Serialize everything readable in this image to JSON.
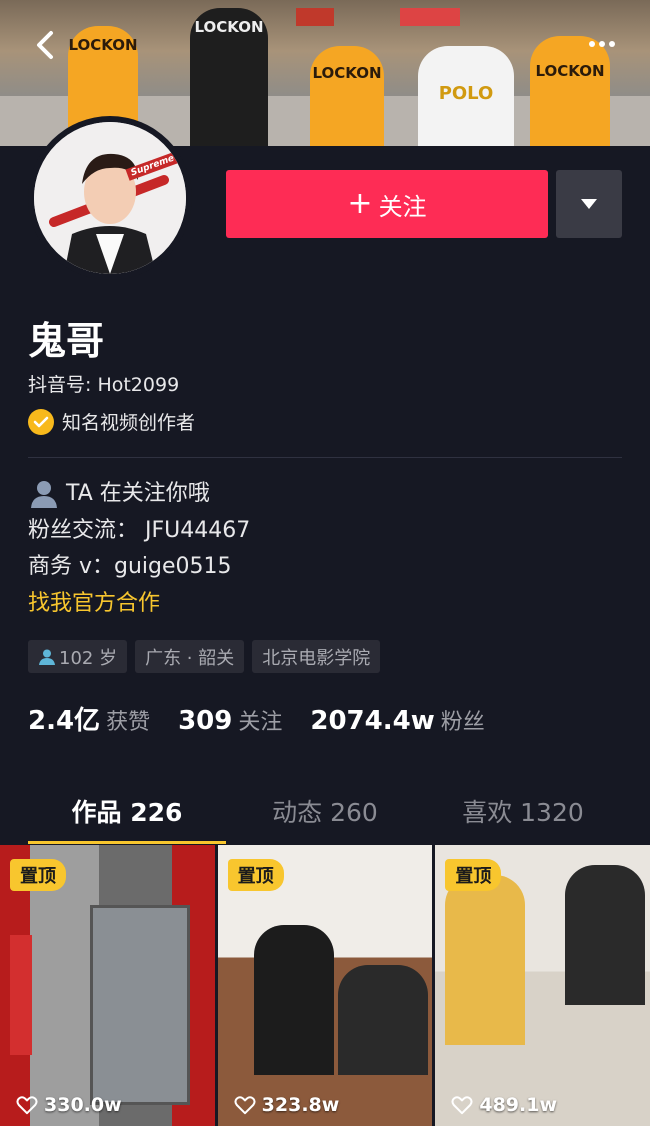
{
  "cover": {
    "shirts": [
      "LOCKON",
      "LOCKON",
      "LOCKON",
      "POLO",
      "LOCKON"
    ]
  },
  "profile": {
    "name": "鬼哥",
    "douyin_id": "抖音号: Hot2099",
    "verified_label": "知名视频创作者",
    "follow_label": "关注",
    "bio": {
      "follows_you": "TA 在关注你哦",
      "fans_line": "粉丝交流：  JFU44467",
      "business_line": "商务 v：guige0515",
      "cooperate_link": "找我官方合作"
    },
    "tags": [
      "102 岁",
      "广东 · 韶关",
      "北京电影学院"
    ],
    "stats": [
      {
        "num": "2.4亿",
        "label": "获赞"
      },
      {
        "num": "309",
        "label": "关注"
      },
      {
        "num": "2074.4w",
        "label": "粉丝"
      }
    ],
    "avatar_text": "Supreme"
  },
  "tabs": [
    {
      "label": "作品 226",
      "active": true
    },
    {
      "label": "动态 260",
      "active": false
    },
    {
      "label": "喜欢 1320",
      "active": false
    }
  ],
  "videos": [
    {
      "pinned": "置顶",
      "likes": "330.0w"
    },
    {
      "pinned": "置顶",
      "likes": "323.8w"
    },
    {
      "pinned": "置顶",
      "likes": "489.1w"
    }
  ],
  "colors": {
    "background": "#161823",
    "follow": "#fe2c55",
    "accent": "#f8c62e",
    "verified": "#f8b91c"
  }
}
